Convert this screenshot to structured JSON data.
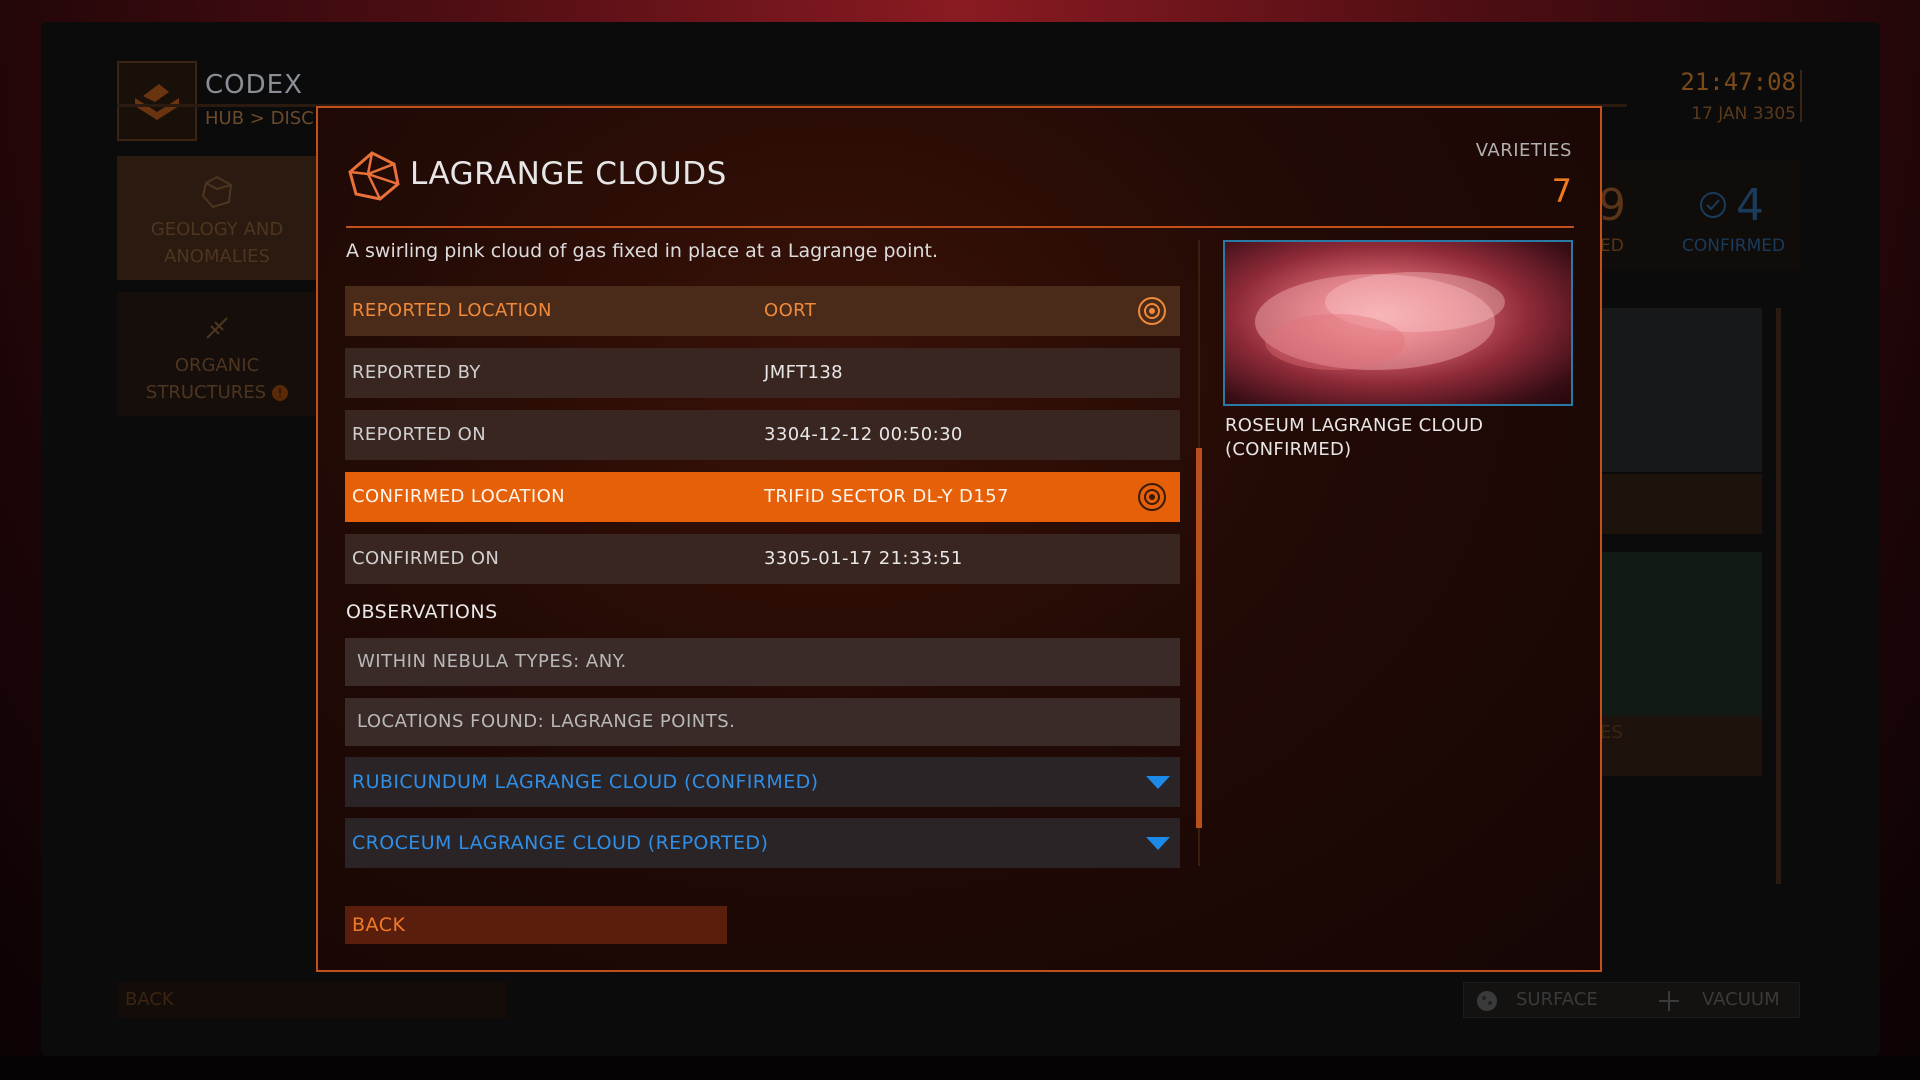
{
  "background_app": {
    "title": "CODEX",
    "breadcrumb": "HUB > DISC",
    "clock": {
      "time": "21:47:08",
      "date": "17 JAN 3305"
    },
    "categories": [
      {
        "label": "GEOLOGY AND ANOMALIES",
        "icon": "geology-icon"
      },
      {
        "label": "ORGANIC STRUCTURES",
        "icon": "organic-icon",
        "alert": "!"
      }
    ],
    "stats": {
      "reported_count": "9",
      "reported_label": "ED",
      "confirmed_count": "4",
      "confirmed_label": "CONFIRMED"
    },
    "card_label": "ES",
    "back_label": "BACK",
    "filters": [
      {
        "label": "SURFACE",
        "icon": "surface-icon"
      },
      {
        "label": "VACUUM",
        "icon": "vacuum-icon"
      }
    ]
  },
  "modal": {
    "title": "LAGRANGE CLOUDS",
    "icon": "geology-icon",
    "varieties_label": "VARIETIES",
    "varieties_count": "7",
    "description": "A swirling pink cloud of gas fixed in place at a Lagrange point.",
    "details": [
      {
        "key": "REPORTED LOCATION",
        "value": "OORT",
        "has_target": true
      },
      {
        "key": "REPORTED BY",
        "value": "JMFT138"
      },
      {
        "key": "REPORTED ON",
        "value": "3304-12-12 00:50:30"
      },
      {
        "key": "CONFIRMED LOCATION",
        "value": "TRIFID SECTOR DL-Y D157",
        "has_target": true
      },
      {
        "key": "CONFIRMED ON",
        "value": "3305-01-17 21:33:51"
      }
    ],
    "observations_heading": "OBSERVATIONS",
    "observations": [
      "WITHIN NEBULA TYPES: ANY.",
      "LOCATIONS FOUND: LAGRANGE POINTS."
    ],
    "varieties": [
      "RUBICUNDUM LAGRANGE CLOUD (CONFIRMED)",
      "CROCEUM LAGRANGE CLOUD (REPORTED)"
    ],
    "image_caption_line1": "ROSEUM LAGRANGE CLOUD",
    "image_caption_line2": "(CONFIRMED)",
    "back_label": "BACK"
  },
  "colors": {
    "accent": "#e56008",
    "accent_text": "#f07a20",
    "variety_text": "#2f8ee6",
    "modal_border": "#c2501a"
  }
}
